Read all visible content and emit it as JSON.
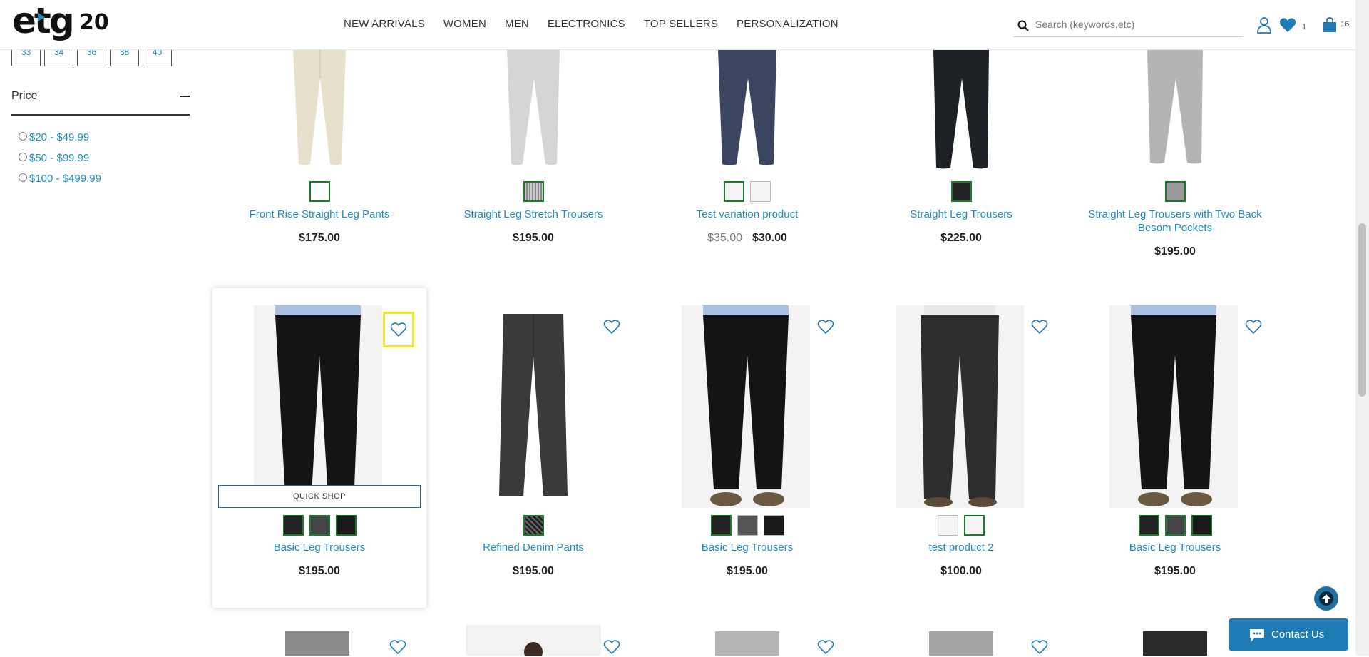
{
  "header": {
    "logo": "etg 20",
    "nav": [
      "NEW ARRIVALS",
      "WOMEN",
      "MEN",
      "ELECTRONICS",
      "TOP SELLERS",
      "PERSONALIZATION"
    ],
    "search_placeholder": "Search (keywords,etc)",
    "wishlist_count": "1",
    "cart_count": "16"
  },
  "sidebar": {
    "sizes": [
      "33",
      "34",
      "36",
      "38",
      "40"
    ],
    "price_label": "Price",
    "price_options": [
      "$20 - $49.99",
      "$50 - $99.99",
      "$100 - $499.99"
    ]
  },
  "products_row1": [
    {
      "name": "Front Rise Straight Leg Pants",
      "price": "$175.00"
    },
    {
      "name": "Straight Leg Stretch Trousers",
      "price": "$195.00"
    },
    {
      "name": "Test variation product",
      "old_price": "$35.00",
      "price": "$30.00"
    },
    {
      "name": "Straight Leg Trousers",
      "price": "$225.00"
    },
    {
      "name": "Straight Leg Trousers with Two Back Besom Pockets",
      "price": "$195.00"
    }
  ],
  "products_row2": [
    {
      "name": "Basic Leg Trousers",
      "price": "$195.00"
    },
    {
      "name": "Refined Denim Pants",
      "price": "$195.00"
    },
    {
      "name": "Basic Leg Trousers",
      "price": "$195.00"
    },
    {
      "name": "test product 2",
      "price": "$100.00"
    },
    {
      "name": "Basic Leg Trousers",
      "price": "$195.00"
    }
  ],
  "quick_shop": "QUICK SHOP",
  "contact_us": "Contact Us",
  "colors": {
    "accent": "#1f8fb8",
    "swatch_border": "#1a7a2a",
    "contact_bg": "#1f7bb3"
  }
}
